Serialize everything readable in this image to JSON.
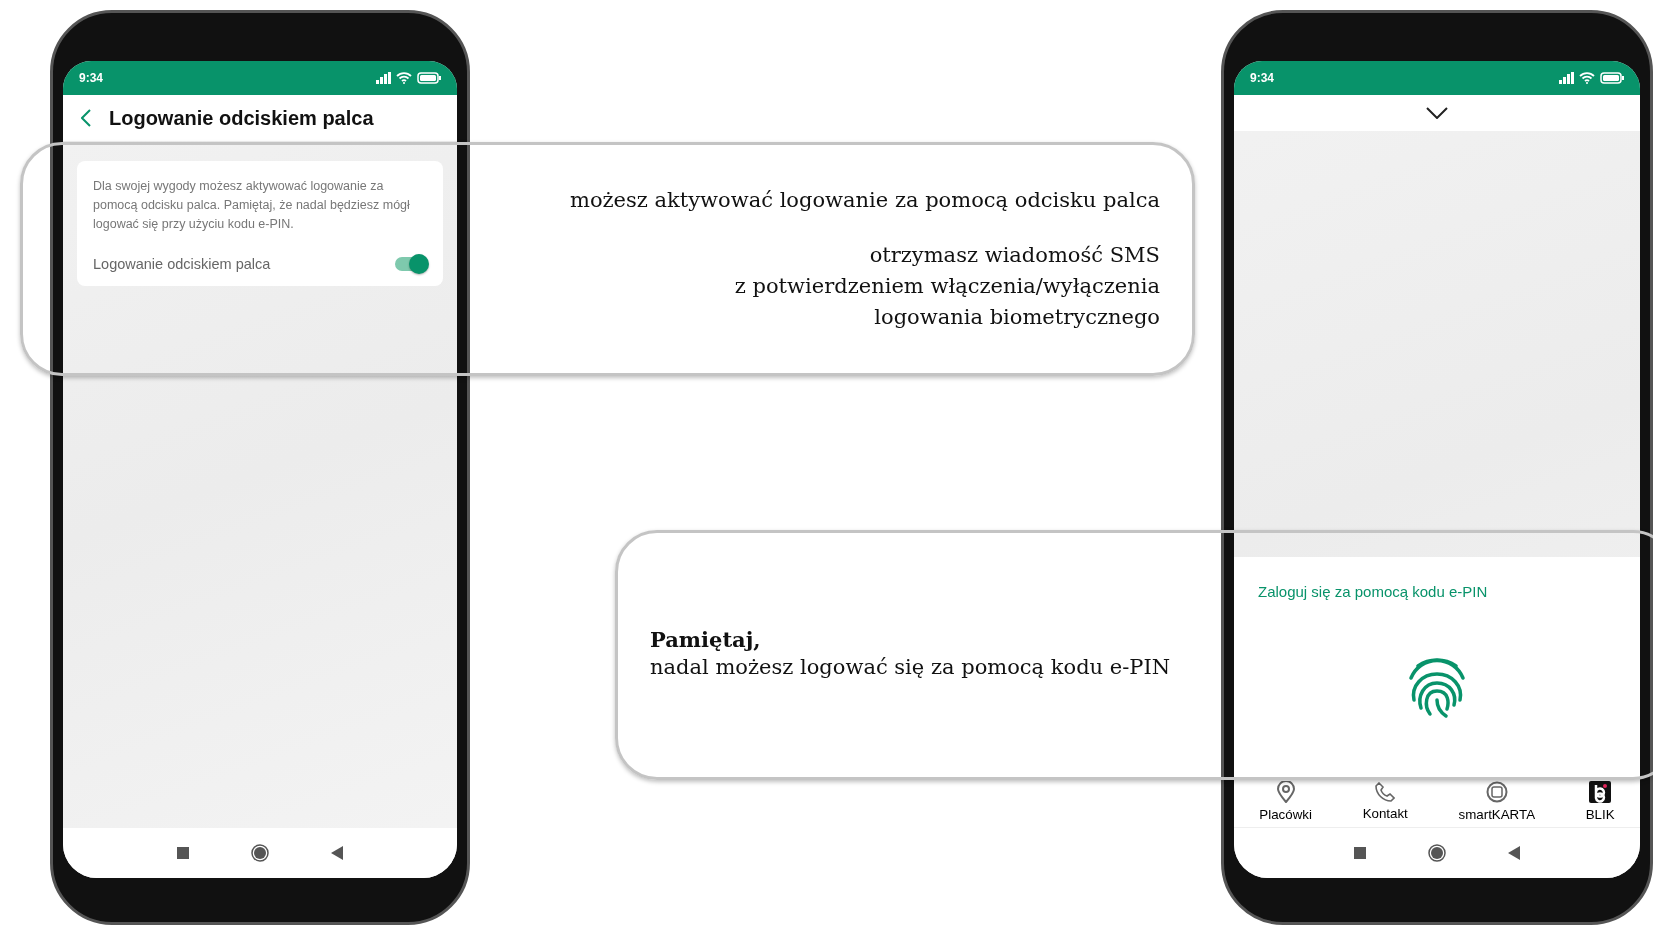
{
  "left_phone": {
    "status_bar": {
      "time": "9:34"
    },
    "header": {
      "title": "Logowanie odciskiem palca"
    },
    "card": {
      "description": "Dla swojej wygody możesz aktywować logowanie za pomocą odcisku palca. Pamiętaj, że nadal będziesz mógł logować się przy użyciu kodu e-PIN.",
      "setting": {
        "label": "Logowanie odciskiem palca",
        "on": true
      }
    }
  },
  "right_phone": {
    "status_bar": {
      "time": "9:34"
    },
    "login_sheet": {
      "title": "Zaloguj się za pomocą kodu e-PIN"
    },
    "bottom_nav": [
      {
        "kind": "pin",
        "label": "Placówki"
      },
      {
        "kind": "phone",
        "label": "Kontakt"
      },
      {
        "kind": "card",
        "label": "smartKARTA"
      },
      {
        "kind": "blik",
        "label": "BLIK"
      }
    ]
  },
  "callouts": [
    {
      "paragraphs": [
        "możesz aktywować logowanie za pomocą odcisku palca",
        "otrzymasz wiadomość SMS\nz potwierdzeniem włączenia/wyłączenia\nlogowania biometrycznego"
      ]
    },
    {
      "heading": "Pamiętaj,",
      "paragraphs": [
        "nadal możesz logować się za pomocą kodu e-PIN"
      ]
    }
  ]
}
